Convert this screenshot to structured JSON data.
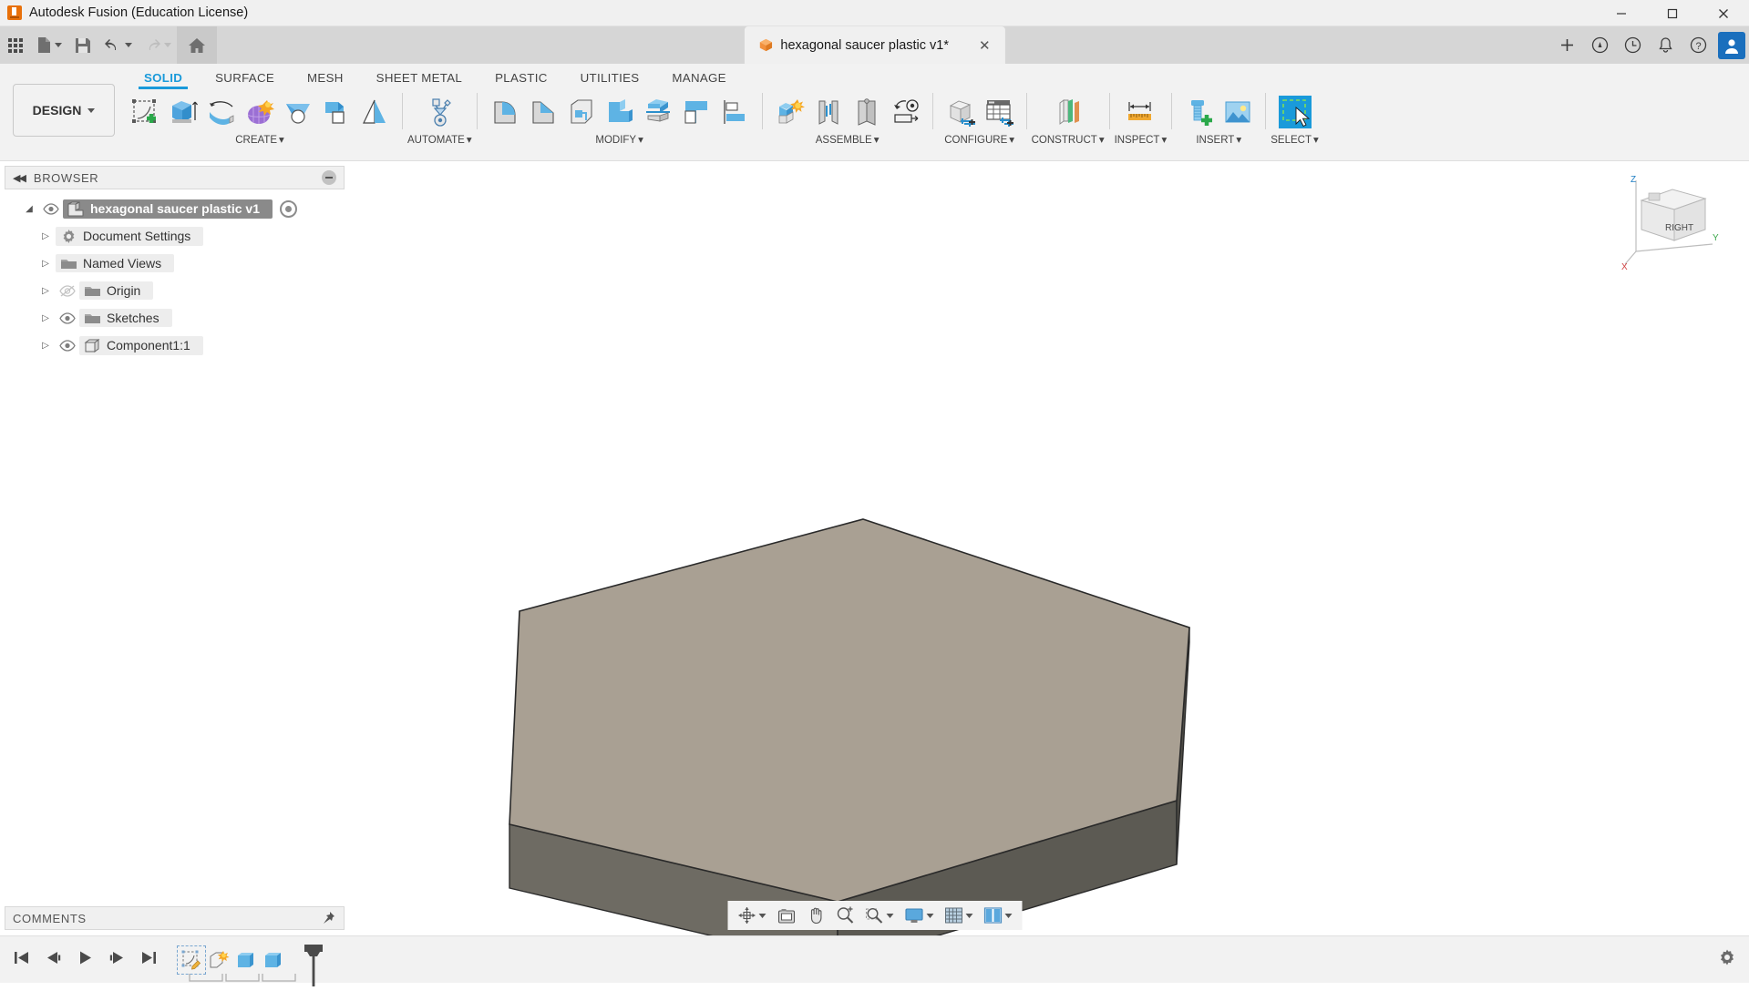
{
  "window": {
    "title": "Autodesk Fusion (Education License)",
    "logo_icon": "fusion-logo-icon",
    "minimize_label": "─",
    "maximize_label": "☐",
    "close_label": "✕"
  },
  "quickbar": {
    "items": [
      {
        "name": "app-grid-button",
        "icon": "grid-icon",
        "caret": false
      },
      {
        "name": "new-document-button",
        "icon": "file-icon",
        "caret": true
      },
      {
        "name": "save-button",
        "icon": "save-icon",
        "caret": false
      },
      {
        "name": "undo-button",
        "icon": "undo-arrow-icon",
        "caret": true
      },
      {
        "name": "redo-button",
        "icon": "redo-arrow-icon",
        "caret": true
      },
      {
        "name": "home-button",
        "icon": "home-icon",
        "caret": false
      }
    ],
    "document_tab": {
      "icon": "orange-cube-icon",
      "label": "hexagonal saucer plastic v1*",
      "close_label": "✕"
    },
    "add_tab_label": "+",
    "right_icons": [
      {
        "name": "help-circle-icon",
        "glyph": "?"
      },
      {
        "name": "recent-activity-icon",
        "glyph": "◔"
      },
      {
        "name": "notifications-bell-icon",
        "glyph": "🔔"
      },
      {
        "name": "help-question-icon",
        "glyph": "?"
      }
    ],
    "avatar_label": "👤"
  },
  "ribbon": {
    "workspace_label": "DESIGN",
    "workspace_caret": "▾",
    "tabs": [
      {
        "label": "SOLID",
        "active": true
      },
      {
        "label": "SURFACE",
        "active": false
      },
      {
        "label": "MESH",
        "active": false
      },
      {
        "label": "SHEET METAL",
        "active": false
      },
      {
        "label": "PLASTIC",
        "active": false
      },
      {
        "label": "UTILITIES",
        "active": false
      },
      {
        "label": "MANAGE",
        "active": false
      }
    ],
    "panels": [
      {
        "title": "CREATE",
        "caret": "▾",
        "tools": [
          "create-sketch-icon",
          "extrude-icon",
          "revolve-icon",
          "form-icon",
          "loft-icon",
          "hole-icon",
          "rib-icon"
        ]
      },
      {
        "title": "AUTOMATE",
        "caret": "▾",
        "tools": [
          "automate-assembly-icon"
        ]
      },
      {
        "title": "MODIFY",
        "caret": "▾",
        "tools": [
          "fillet-icon",
          "chamfer-icon",
          "shell-icon",
          "combine-icon",
          "split-body-icon",
          "offset-face-icon",
          "align-icon"
        ]
      },
      {
        "title": "ASSEMBLE",
        "caret": "▾",
        "tools": [
          "new-component-icon",
          "joint-icon",
          "as-built-joint-icon",
          "motion-link-icon"
        ]
      },
      {
        "title": "CONFIGURE",
        "caret": "▾",
        "tools": [
          "configuration-icon",
          "configuration-table-icon"
        ]
      },
      {
        "title": "CONSTRUCT",
        "caret": "▾",
        "tools": [
          "offset-plane-icon"
        ]
      },
      {
        "title": "INSPECT",
        "caret": "▾",
        "tools": [
          "measure-ruler-icon"
        ]
      },
      {
        "title": "INSERT",
        "caret": "▾",
        "tools": [
          "insert-mcmaster-icon",
          "insert-image-icon"
        ]
      },
      {
        "title": "SELECT",
        "caret": "▾",
        "tools": [
          "select-window-icon"
        ]
      }
    ]
  },
  "browser": {
    "header": "BROWSER",
    "collapse_icon": "collapse-left-icon",
    "options_icon": "panel-options-icon",
    "tree": [
      {
        "name": "root",
        "label": "hexagonal saucer plastic v1",
        "icon": "document-component-icon",
        "expander": "◢",
        "eye": "eye-visible-icon",
        "selected": true,
        "indent": 0,
        "has_occurrence_dot": true
      },
      {
        "name": "document-settings",
        "label": "Document Settings",
        "icon": "gear-icon",
        "expander": "▷",
        "eye": null,
        "selected": false,
        "indent": 1,
        "has_occurrence_dot": false
      },
      {
        "name": "named-views",
        "label": "Named Views",
        "icon": "folder-icon",
        "expander": "▷",
        "eye": null,
        "selected": false,
        "indent": 1,
        "has_occurrence_dot": false
      },
      {
        "name": "origin",
        "label": "Origin",
        "icon": "folder-icon",
        "expander": "▷",
        "eye": "eye-hidden-icon",
        "selected": false,
        "indent": 1,
        "has_occurrence_dot": false
      },
      {
        "name": "sketches",
        "label": "Sketches",
        "icon": "folder-icon",
        "expander": "▷",
        "eye": "eye-visible-icon",
        "selected": false,
        "indent": 1,
        "has_occurrence_dot": false
      },
      {
        "name": "component1",
        "label": "Component1:1",
        "icon": "body-cube-icon",
        "expander": "▷",
        "eye": "eye-visible-icon",
        "selected": false,
        "indent": 1,
        "has_occurrence_dot": false
      }
    ]
  },
  "comments": {
    "header": "COMMENTS",
    "pin_icon": "pin-icon"
  },
  "viewcube": {
    "face_label": "RIGHT",
    "axis_z": "Z",
    "axis_x": "X",
    "axis_y": "Y"
  },
  "model": {
    "description": "hexagonal extruded plate",
    "top_face_color": "#a9a093",
    "front_face_color": "#5c5a53",
    "side_face_color": "#6e6b63",
    "edge_color": "#2a2a2a"
  },
  "navbar": {
    "items": [
      {
        "name": "orbit-button",
        "icon": "orbit-icon",
        "caret": true
      },
      {
        "name": "look-at-button",
        "icon": "look-at-icon",
        "caret": false
      },
      {
        "name": "pan-button",
        "icon": "pan-hand-icon",
        "caret": false
      },
      {
        "name": "zoom-button",
        "icon": "zoom-in-magnifier-icon",
        "caret": false
      },
      {
        "name": "fit-button",
        "icon": "zoom-window-icon",
        "caret": true
      },
      {
        "name": "display-settings-button",
        "icon": "monitor-icon",
        "caret": true
      },
      {
        "name": "grid-snaps-button",
        "icon": "grid-snap-icon",
        "caret": true
      },
      {
        "name": "viewports-button",
        "icon": "viewports-icon",
        "caret": true
      }
    ]
  },
  "timeline": {
    "controls": [
      {
        "name": "go-to-beginning-button",
        "icon": "skip-back-icon"
      },
      {
        "name": "step-back-button",
        "icon": "step-back-icon"
      },
      {
        "name": "play-button",
        "icon": "play-icon"
      },
      {
        "name": "step-forward-button",
        "icon": "step-forward-icon"
      },
      {
        "name": "go-to-end-button",
        "icon": "skip-end-icon"
      }
    ],
    "features": [
      {
        "name": "timeline-sketch-feature",
        "icon": "sketch-feature-icon",
        "selected": true
      },
      {
        "name": "timeline-new-component-feature",
        "icon": "new-component-feature-icon",
        "selected": false
      },
      {
        "name": "timeline-extrude-feature-1",
        "icon": "extrude-feature-icon",
        "selected": false
      },
      {
        "name": "timeline-extrude-feature-2",
        "icon": "extrude-feature-icon",
        "selected": false
      }
    ],
    "settings_icon": "gear-icon"
  }
}
